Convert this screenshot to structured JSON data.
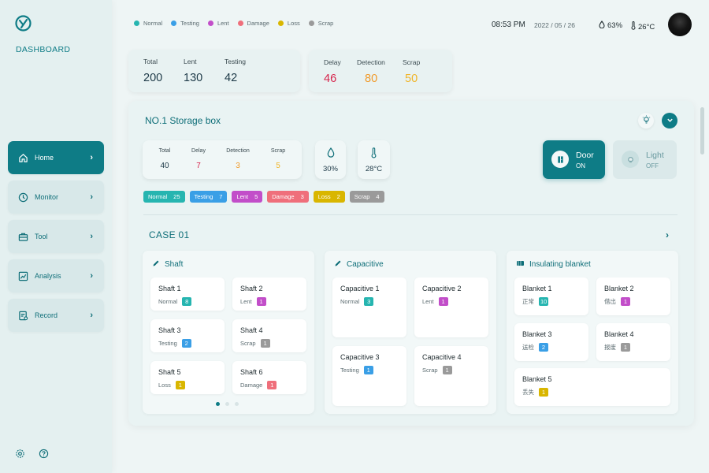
{
  "sidebar": {
    "brand": "DASHBOARD",
    "logo_icon": "logo-icon",
    "items": [
      {
        "label": "Home",
        "icon": "home-icon",
        "active": true
      },
      {
        "label": "Monitor",
        "icon": "monitor-icon",
        "active": false
      },
      {
        "label": "Tool",
        "icon": "toolbox-icon",
        "active": false
      },
      {
        "label": "Analysis",
        "icon": "chart-icon",
        "active": false
      },
      {
        "label": "Record",
        "icon": "record-icon",
        "active": false
      }
    ],
    "bottom_icons": [
      "settings-icon",
      "help-icon"
    ]
  },
  "legend": [
    {
      "label": "Normal",
      "color": "#26b5b0"
    },
    {
      "label": "Testing",
      "color": "#3a9fe6"
    },
    {
      "label": "Lent",
      "color": "#c24ec9"
    },
    {
      "label": "Damage",
      "color": "#ef6f7b"
    },
    {
      "label": "Loss",
      "color": "#d9b600"
    },
    {
      "label": "Scrap",
      "color": "#9a9a9a"
    }
  ],
  "header": {
    "time": "08:53 PM",
    "date": "2022 / 05 / 26",
    "humidity": "63%",
    "temperature": "26°C"
  },
  "summary": {
    "left": [
      {
        "label": "Total",
        "value": "200",
        "color": "#1e3a48"
      },
      {
        "label": "Lent",
        "value": "130",
        "color": "#1e3a48"
      },
      {
        "label": "Testing",
        "value": "42",
        "color": "#1e3a48"
      }
    ],
    "right": [
      {
        "label": "Delay",
        "value": "46",
        "color": "#d6244c"
      },
      {
        "label": "Detection",
        "value": "80",
        "color": "#f09a2a"
      },
      {
        "label": "Scrap",
        "value": "50",
        "color": "#f0b52a"
      }
    ]
  },
  "storage": {
    "title": "NO.1 Storage box",
    "stats": [
      {
        "label": "Total",
        "value": "40",
        "color": "#1e3a48"
      },
      {
        "label": "Delay",
        "value": "7",
        "color": "#d6244c"
      },
      {
        "label": "Detection",
        "value": "3",
        "color": "#f09a2a"
      },
      {
        "label": "Scrap",
        "value": "5",
        "color": "#f0b52a"
      }
    ],
    "humidity": "30%",
    "temperature": "28°C",
    "door": {
      "name": "Door",
      "state": "ON"
    },
    "light": {
      "name": "Light",
      "state": "OFF"
    },
    "chips": [
      {
        "label": "Normal",
        "count": "25",
        "color": "#26b5b0"
      },
      {
        "label": "Testing",
        "count": "7",
        "color": "#3a9fe6"
      },
      {
        "label": "Lent",
        "count": "5",
        "color": "#c24ec9"
      },
      {
        "label": "Damage",
        "count": "3",
        "color": "#ef6f7b"
      },
      {
        "label": "Loss",
        "count": "2",
        "color": "#d9b600"
      },
      {
        "label": "Scrap",
        "count": "4",
        "color": "#9a9a9a"
      }
    ]
  },
  "case": {
    "title": "CASE 01",
    "groups": [
      {
        "title": "Shaft",
        "icon": "pen-icon",
        "items": [
          {
            "name": "Shaft 1",
            "status": "Normal",
            "count": "8",
            "color": "#26b5b0"
          },
          {
            "name": "Shaft 2",
            "status": "Lent",
            "count": "1",
            "color": "#c24ec9"
          },
          {
            "name": "Shaft 3",
            "status": "Testing",
            "count": "2",
            "color": "#3a9fe6"
          },
          {
            "name": "Shaft 4",
            "status": "Scrap",
            "count": "1",
            "color": "#9a9a9a"
          },
          {
            "name": "Shaft 5",
            "status": "Loss",
            "count": "1",
            "color": "#d9b600"
          },
          {
            "name": "Shaft 6",
            "status": "Damage",
            "count": "1",
            "color": "#ef6f7b"
          }
        ]
      },
      {
        "title": "Capacitive",
        "icon": "pen-icon",
        "items": [
          {
            "name": "Capacitive 1",
            "status": "Normal",
            "count": "3",
            "color": "#26b5b0"
          },
          {
            "name": "Capacitive 2",
            "status": "Lent",
            "count": "1",
            "color": "#c24ec9"
          },
          {
            "name": "Capacitive 3",
            "status": "Testing",
            "count": "1",
            "color": "#3a9fe6"
          },
          {
            "name": "Capacitive 4",
            "status": "Scrap",
            "count": "1",
            "color": "#9a9a9a"
          }
        ]
      },
      {
        "title": "Insulating blanket",
        "icon": "blanket-icon",
        "items": [
          {
            "name": "Blanket 1",
            "status": "正常",
            "count": "10",
            "color": "#26b5b0"
          },
          {
            "name": "Blanket 2",
            "status": "借出",
            "count": "1",
            "color": "#c24ec9"
          },
          {
            "name": "Blanket 3",
            "status": "送检",
            "count": "2",
            "color": "#3a9fe6"
          },
          {
            "name": "Blanket 4",
            "status": "报废",
            "count": "1",
            "color": "#9a9a9a"
          },
          {
            "name": "Blanket 5",
            "status": "丢失",
            "count": "1",
            "color": "#d9b600"
          }
        ]
      }
    ]
  }
}
